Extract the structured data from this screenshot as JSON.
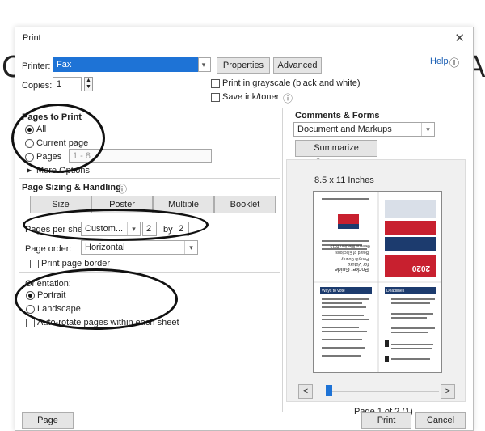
{
  "dialog": {
    "title": "Print",
    "close_glyph": "✕"
  },
  "background_letters": {
    "left": "C",
    "right": "A"
  },
  "printer": {
    "label": "Printer:",
    "value": "Fax",
    "properties_label": "Properties",
    "advanced_label": "Advanced",
    "help_label": "Help",
    "help_icon": "ⓘ"
  },
  "copies": {
    "label": "Copies:",
    "value": "1"
  },
  "options": {
    "grayscale_label": "Print in grayscale (black and white)",
    "save_ink_label": "Save ink/toner",
    "info_glyph": "ⓘ"
  },
  "pages_to_print": {
    "title": "Pages to Print",
    "all_label": "All",
    "current_label": "Current page",
    "pages_label": "Pages",
    "pages_value": "1 - 8",
    "more_label": "More Options"
  },
  "sizing": {
    "title": "Page Sizing & Handling",
    "info_glyph": "ⓘ",
    "tabs": [
      "Size",
      "Poster",
      "Multiple",
      "Booklet"
    ],
    "per_sheet_label": "Pages per sheet:",
    "per_sheet_value": "Custom...",
    "cols": "2",
    "by_label": "by",
    "rows": "2",
    "order_label": "Page order:",
    "order_value": "Horizontal",
    "border_label": "Print page border"
  },
  "orientation": {
    "title": "Orientation:",
    "portrait_label": "Portrait",
    "landscape_label": "Landscape",
    "autorotate_label": "Auto-rotate pages within each sheet"
  },
  "comments": {
    "title": "Comments & Forms",
    "value": "Document and Markups",
    "summarize_label": "Summarize Comments"
  },
  "preview": {
    "size_label": "8.5 x 11 Inches",
    "prev_glyph": "<",
    "next_glyph": ">",
    "page_status": "Page 1 of 2 (1)",
    "slider_level": 0,
    "thumb_texts": {
      "guide_title": "Pocket Guide",
      "guide_sub": "for Voters",
      "county": "Forsyth County",
      "board": "Board of Elections",
      "election": "General Election 2019",
      "year": "2020",
      "ways": "Ways to vote",
      "deadlines": "Deadlines"
    }
  },
  "footer": {
    "setup_label": "Page Setup...",
    "print_label": "Print",
    "cancel_label": "Cancel"
  },
  "colors": {
    "accent": "#1e73d6",
    "annotation": "#111111",
    "thumb_red": "#c8202f",
    "thumb_blue": "#1c3b6e"
  }
}
